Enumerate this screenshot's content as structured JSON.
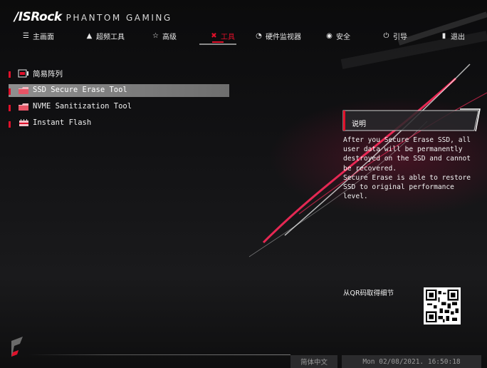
{
  "header": {
    "brand": "/ISRock",
    "subtitle": "PHANTOM GAMING",
    "tabs": [
      {
        "label": "主画面",
        "icon": "list-icon"
      },
      {
        "label": "超频工具",
        "icon": "flame-icon"
      },
      {
        "label": "高级",
        "icon": "star-icon"
      },
      {
        "label": "工具",
        "icon": "tools-icon",
        "active": true
      },
      {
        "label": "硬件监视器",
        "icon": "monitor-icon"
      },
      {
        "label": "安全",
        "icon": "shield-icon"
      },
      {
        "label": "引导",
        "icon": "power-icon"
      },
      {
        "label": "退出",
        "icon": "exit-door-icon"
      }
    ]
  },
  "menu": {
    "items": [
      {
        "label": "简易阵列",
        "icon": "raid-icon"
      },
      {
        "label": "SSD Secure Erase Tool",
        "icon": "folder-icon",
        "selected": true
      },
      {
        "label": "NVME Sanitization Tool",
        "icon": "folder-icon"
      },
      {
        "label": "Instant Flash",
        "icon": "flash-chip-icon"
      }
    ]
  },
  "help": {
    "title": "说明",
    "text": "After you Secure Erase SSD, all\nuser data will be permanently\ndestroyed on the SSD and cannot\nbe recovered.\nSecure Erase is able to restore\nSSD to original performance level.",
    "qr_label": "从QR码取得细节"
  },
  "footer": {
    "language": "简体中文",
    "datetime": "Mon 02/08/2021. 16:50:18"
  },
  "colors": {
    "accent": "#e0102a",
    "selected_bg": "#8a8a8a",
    "footer_bg": "#2b2b2d"
  }
}
